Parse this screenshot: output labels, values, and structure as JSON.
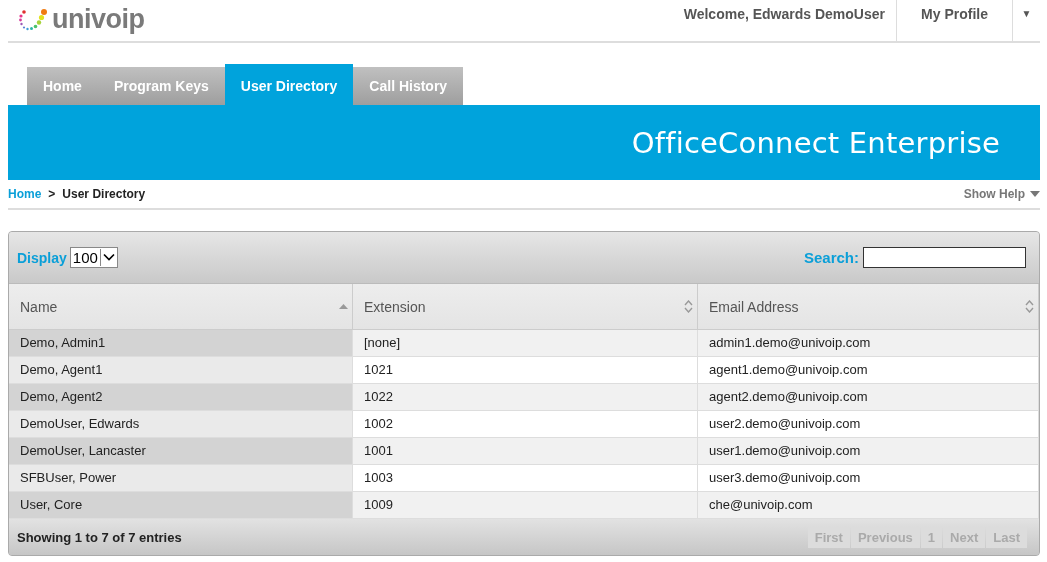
{
  "header": {
    "logo": "univoip",
    "welcome": "Welcome, Edwards DemoUser",
    "profile": "My Profile",
    "menu_caret": "▼"
  },
  "tabs": [
    {
      "label": "Home",
      "selected": false
    },
    {
      "label": "Program Keys",
      "selected": false
    },
    {
      "label": "User Directory",
      "selected": true
    },
    {
      "label": "Call History",
      "selected": false
    }
  ],
  "banner": {
    "title": "OfficeConnect Enterprise"
  },
  "breadcrumb": [
    {
      "label": "Home",
      "kind": "link"
    },
    {
      "label": ">",
      "kind": "separator"
    },
    {
      "label": "User Directory",
      "kind": "current"
    }
  ],
  "help": {
    "label": "Show Help"
  },
  "table_controls": {
    "display_label": "Display",
    "display_value": "100",
    "search_label": "Search:"
  },
  "table": {
    "columns": [
      {
        "label": "Name",
        "sorted": true
      },
      {
        "label": "Extension",
        "sorted": false
      },
      {
        "label": "Email Address",
        "sorted": false
      }
    ],
    "rows": [
      [
        "Demo, Admin1",
        "[none]",
        "admin1.demo@univoip.com"
      ],
      [
        "Demo, Agent1",
        "1021",
        "agent1.demo@univoip.com"
      ],
      [
        "Demo, Agent2",
        "1022",
        "agent2.demo@univoip.com"
      ],
      [
        "DemoUser, Edwards",
        "1002",
        "user2.demo@univoip.com"
      ],
      [
        "DemoUser, Lancaster",
        "1001",
        "user1.demo@univoip.com"
      ],
      [
        "SFBUser, Power",
        "1003",
        "user3.demo@univoip.com"
      ],
      [
        "User, Core",
        "1009",
        "che@univoip.com"
      ]
    ]
  },
  "footer": {
    "info": "Showing 1 to 7 of 7 entries",
    "pager": [
      {
        "label": "First",
        "disabled": true
      },
      {
        "label": "Previous",
        "disabled": true
      },
      {
        "label": "1",
        "disabled": true
      },
      {
        "label": "Next",
        "disabled": true
      },
      {
        "label": "Last",
        "disabled": true
      }
    ]
  }
}
